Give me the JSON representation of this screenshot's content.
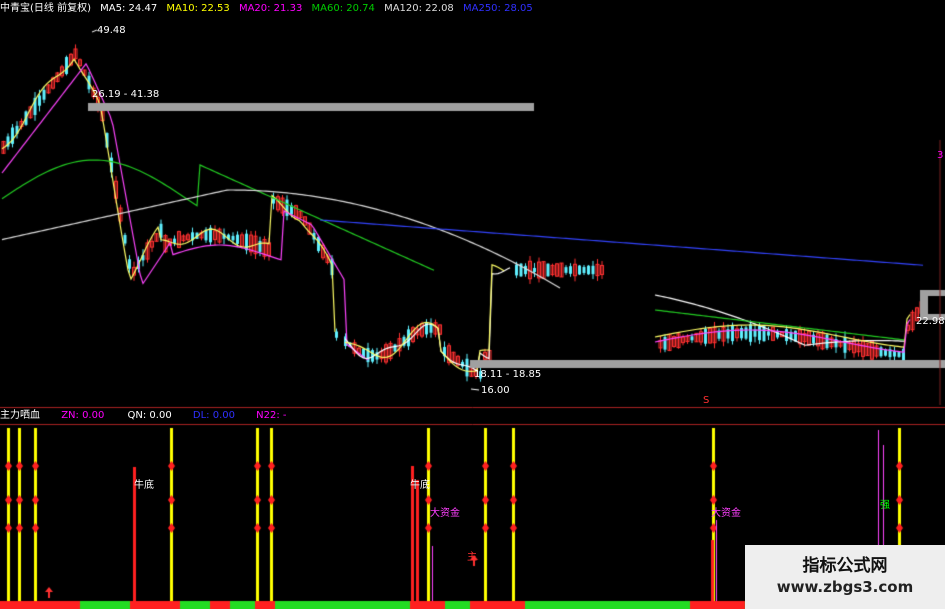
{
  "header": {
    "title": "中青宝(日线 前复权)",
    "ma": [
      {
        "label": "MA5: 24.47",
        "color": "#ffffff"
      },
      {
        "label": "MA10: 22.53",
        "color": "#ffff00"
      },
      {
        "label": "MA20: 21.33",
        "color": "#ff00ff"
      },
      {
        "label": "MA60: 20.74",
        "color": "#00cc00"
      },
      {
        "label": "MA120: 22.08",
        "color": "#dddddd"
      },
      {
        "label": "MA250: 28.05",
        "color": "#3030ff"
      }
    ]
  },
  "indicator_header": {
    "title": "主力哂血",
    "items": [
      {
        "label": "ZN: 0.00",
        "color": "#ff00ff"
      },
      {
        "label": "QN: 0.00",
        "color": "#ffffff"
      },
      {
        "label": "DL: 0.00",
        "color": "#3030ff"
      },
      {
        "label": "N22: -",
        "color": "#ff00ff"
      }
    ]
  },
  "price_labels": {
    "high": "49.48",
    "range_upper": "26.19 - 41.38",
    "range_lower": "18.11 - 18.85",
    "low": "16.00",
    "right_price": "22.98",
    "axis_marker": "3",
    "small_marker": "S"
  },
  "signals": {
    "niudi": "牛底",
    "dazijin": "大资金",
    "zhuli": "主",
    "qiang": "强"
  },
  "watermark": {
    "line1": "指标公式网",
    "line2": "www.zbgs3.com"
  },
  "colors": {
    "background": "#000000",
    "up_candle": "#ff3030",
    "down_candle": "#5ff0ff",
    "signal_yellow": "#ffff00",
    "signal_red": "#ff2020",
    "band_grey": "#a0a0a0",
    "bar_green": "#22dd22"
  }
}
